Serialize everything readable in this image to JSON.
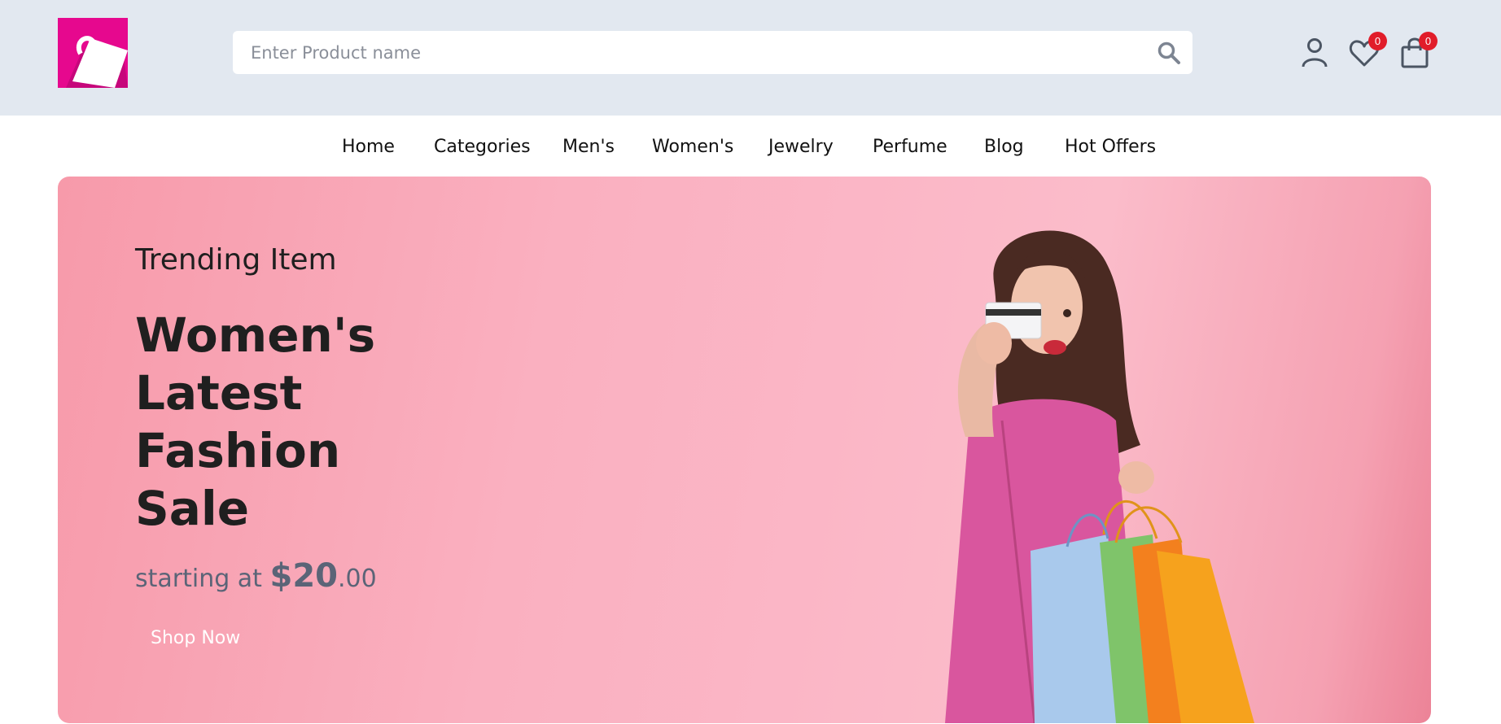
{
  "header": {
    "search": {
      "placeholder": "Enter Product name",
      "value": ""
    },
    "icons": {
      "logo": "shopping-bag-logo",
      "search": "search-icon",
      "account": "user-icon",
      "wishlist": "heart-icon",
      "cart": "shopping-bag-icon"
    },
    "wishlist_count": "0",
    "cart_count": "0"
  },
  "nav": {
    "items": [
      "Home",
      "Categories",
      "Men's",
      "Women's",
      "Jewelry",
      "Perfume",
      "Blog",
      "Hot Offers"
    ]
  },
  "hero": {
    "subtitle": "Trending Item",
    "title": "Women's Latest Fashion Sale",
    "price_prefix": "starting at",
    "price_main": "$20",
    "price_cents": ".00",
    "cta": "Shop Now"
  },
  "colors": {
    "topbar_bg": "#e2e8f0",
    "brand": "#e6088e",
    "badge": "#e11d2a",
    "hero_bg": "#fbb6c6"
  }
}
